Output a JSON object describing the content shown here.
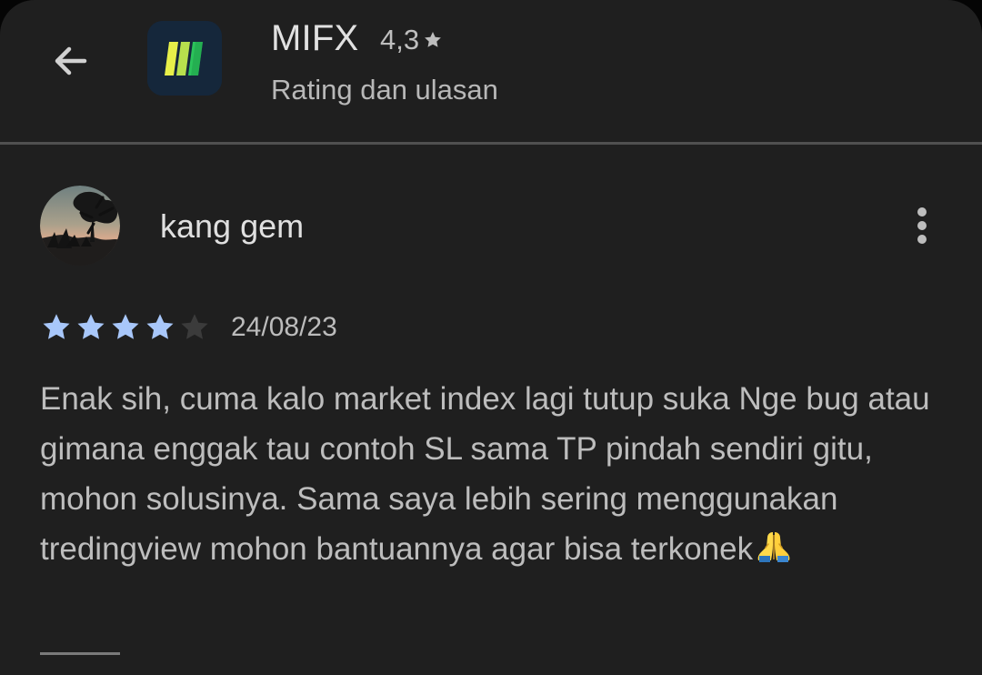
{
  "header": {
    "back_icon": "arrow-back-icon",
    "app_icon": "mifx-app-icon",
    "app_name": "MIFX",
    "app_rating": "4,3",
    "rating_star_icon": "star-icon",
    "subtitle": "Rating dan ulasan"
  },
  "review": {
    "avatar": "sunset-tree-avatar",
    "reviewer_name": "kang gem",
    "more_icon": "more-vertical-icon",
    "rating": 4,
    "max_rating": 5,
    "date": "24/08/23",
    "text": "Enak sih, cuma kalo market index lagi tutup suka Nge bug atau gimana enggak tau contoh SL sama TP pindah sendiri gitu, mohon solusinya. Sama saya lebih sering menggunakan tredingview mohon bantuannya agar bisa terkonek",
    "emoji": "folded-hands-icon"
  },
  "colors": {
    "background": "#1f1f1f",
    "text_primary": "#e0e0e0",
    "text_secondary": "#bdbdbd",
    "star_filled": "#a8c7fa",
    "star_empty": "#3b3b3b",
    "divider": "#505050"
  }
}
